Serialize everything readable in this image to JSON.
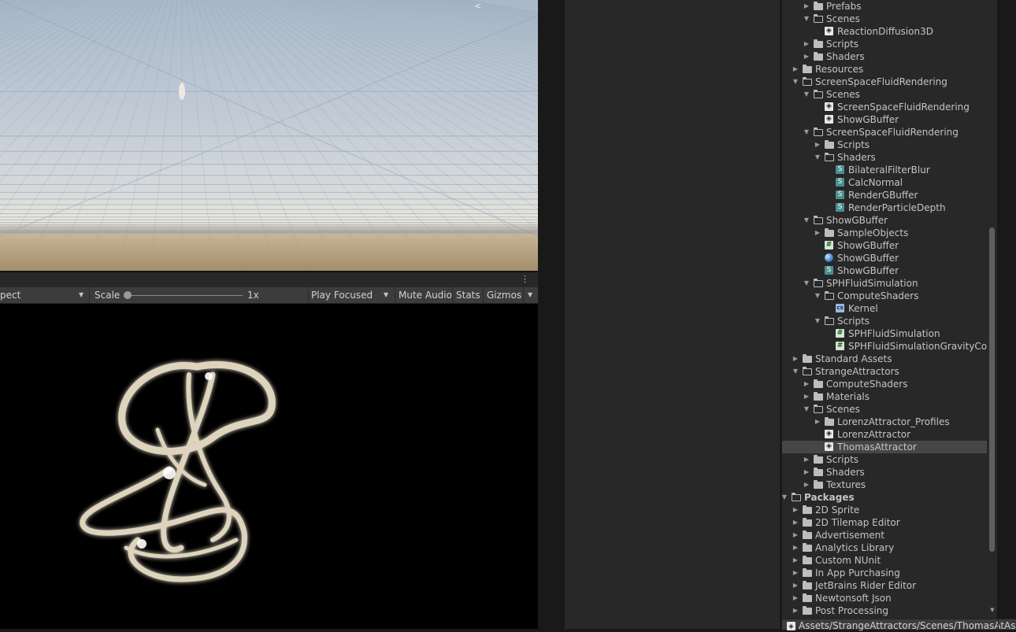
{
  "game_toolbar": {
    "aspect_label": "pect",
    "scale_label": "Scale",
    "scale_value": "1x",
    "play_mode_label": "Play Focused",
    "mute_audio_label": "Mute Audio",
    "stats_label": "Stats",
    "gizmos_label": "Gizmos"
  },
  "project_tree": {
    "rows": [
      {
        "label": "Prefabs",
        "indent": 3,
        "arrow": "right",
        "icon": "folder-icon"
      },
      {
        "label": "Scenes",
        "indent": 3,
        "arrow": "down",
        "icon": "open-folder-icon"
      },
      {
        "label": "ReactionDiffusion3D",
        "indent": 4,
        "arrow": "",
        "icon": "scene-icon"
      },
      {
        "label": "Scripts",
        "indent": 3,
        "arrow": "right",
        "icon": "folder-icon"
      },
      {
        "label": "Shaders",
        "indent": 3,
        "arrow": "right",
        "icon": "folder-icon"
      },
      {
        "label": "Resources",
        "indent": 2,
        "arrow": "right",
        "icon": "folder-icon"
      },
      {
        "label": "ScreenSpaceFluidRendering",
        "indent": 2,
        "arrow": "down",
        "icon": "open-folder-icon"
      },
      {
        "label": "Scenes",
        "indent": 3,
        "arrow": "down",
        "icon": "open-folder-icon"
      },
      {
        "label": "ScreenSpaceFluidRendering",
        "indent": 4,
        "arrow": "",
        "icon": "scene-icon"
      },
      {
        "label": "ShowGBuffer",
        "indent": 4,
        "arrow": "",
        "icon": "scene-icon"
      },
      {
        "label": "ScreenSpaceFluidRendering",
        "indent": 3,
        "arrow": "down",
        "icon": "open-folder-icon"
      },
      {
        "label": "Scripts",
        "indent": 4,
        "arrow": "right",
        "icon": "folder-icon"
      },
      {
        "label": "Shaders",
        "indent": 4,
        "arrow": "down",
        "icon": "open-folder-icon"
      },
      {
        "label": "BilateralFilterBlur",
        "indent": 5,
        "arrow": "",
        "icon": "shader-icon"
      },
      {
        "label": "CalcNormal",
        "indent": 5,
        "arrow": "",
        "icon": "shader-icon"
      },
      {
        "label": "RenderGBuffer",
        "indent": 5,
        "arrow": "",
        "icon": "shader-icon"
      },
      {
        "label": "RenderParticleDepth",
        "indent": 5,
        "arrow": "",
        "icon": "shader-icon"
      },
      {
        "label": "ShowGBuffer",
        "indent": 3,
        "arrow": "down",
        "icon": "open-folder-icon"
      },
      {
        "label": "SampleObjects",
        "indent": 4,
        "arrow": "right",
        "icon": "folder-icon"
      },
      {
        "label": "ShowGBuffer",
        "indent": 4,
        "arrow": "",
        "icon": "script-icon"
      },
      {
        "label": "ShowGBuffer",
        "indent": 4,
        "arrow": "",
        "icon": "material-icon"
      },
      {
        "label": "ShowGBuffer",
        "indent": 4,
        "arrow": "",
        "icon": "shader-icon"
      },
      {
        "label": "SPHFluidSimulation",
        "indent": 3,
        "arrow": "down",
        "icon": "open-folder-icon"
      },
      {
        "label": "ComputeShaders",
        "indent": 4,
        "arrow": "down",
        "icon": "open-folder-icon"
      },
      {
        "label": "Kernel",
        "indent": 5,
        "arrow": "",
        "icon": "compute-shader-icon"
      },
      {
        "label": "Scripts",
        "indent": 4,
        "arrow": "down",
        "icon": "open-folder-icon"
      },
      {
        "label": "SPHFluidSimulation",
        "indent": 5,
        "arrow": "",
        "icon": "script-icon"
      },
      {
        "label": "SPHFluidSimulationGravityCo",
        "indent": 5,
        "arrow": "",
        "icon": "script-icon"
      },
      {
        "label": "Standard Assets",
        "indent": 2,
        "arrow": "right",
        "icon": "folder-icon"
      },
      {
        "label": "StrangeAttractors",
        "indent": 2,
        "arrow": "down",
        "icon": "open-folder-icon"
      },
      {
        "label": "ComputeShaders",
        "indent": 3,
        "arrow": "right",
        "icon": "folder-icon"
      },
      {
        "label": "Materials",
        "indent": 3,
        "arrow": "right",
        "icon": "folder-icon"
      },
      {
        "label": "Scenes",
        "indent": 3,
        "arrow": "down",
        "icon": "open-folder-icon"
      },
      {
        "label": "LorenzAttractor_Profiles",
        "indent": 4,
        "arrow": "right",
        "icon": "folder-icon"
      },
      {
        "label": "LorenzAttractor",
        "indent": 4,
        "arrow": "",
        "icon": "scene-icon"
      },
      {
        "label": "ThomasAttractor",
        "indent": 4,
        "arrow": "",
        "icon": "scene-icon",
        "selected": true
      },
      {
        "label": "Scripts",
        "indent": 3,
        "arrow": "right",
        "icon": "folder-icon"
      },
      {
        "label": "Shaders",
        "indent": 3,
        "arrow": "right",
        "icon": "folder-icon"
      },
      {
        "label": "Textures",
        "indent": 3,
        "arrow": "right",
        "icon": "folder-icon"
      },
      {
        "label": "Packages",
        "indent": 1,
        "arrow": "down",
        "icon": "open-folder-icon",
        "bold": true
      },
      {
        "label": "2D Sprite",
        "indent": 2,
        "arrow": "right",
        "icon": "folder-icon"
      },
      {
        "label": "2D Tilemap Editor",
        "indent": 2,
        "arrow": "right",
        "icon": "folder-icon"
      },
      {
        "label": "Advertisement",
        "indent": 2,
        "arrow": "right",
        "icon": "folder-icon"
      },
      {
        "label": "Analytics Library",
        "indent": 2,
        "arrow": "right",
        "icon": "folder-icon"
      },
      {
        "label": "Custom NUnit",
        "indent": 2,
        "arrow": "right",
        "icon": "folder-icon"
      },
      {
        "label": "In App Purchasing",
        "indent": 2,
        "arrow": "right",
        "icon": "folder-icon"
      },
      {
        "label": "JetBrains Rider Editor",
        "indent": 2,
        "arrow": "right",
        "icon": "folder-icon"
      },
      {
        "label": "Newtonsoft Json",
        "indent": 2,
        "arrow": "right",
        "icon": "folder-icon"
      },
      {
        "label": "Post Processing",
        "indent": 2,
        "arrow": "right",
        "icon": "folder-icon"
      }
    ]
  },
  "status_bar": {
    "path": "Assets/StrangeAttractors/Scenes/ThomasAt",
    "extra": "As"
  },
  "colors": {
    "panel_bg": "#282828",
    "selected_row": "#464646",
    "toolbar_bg": "#3c3c3c",
    "text": "#c4c4c4"
  }
}
